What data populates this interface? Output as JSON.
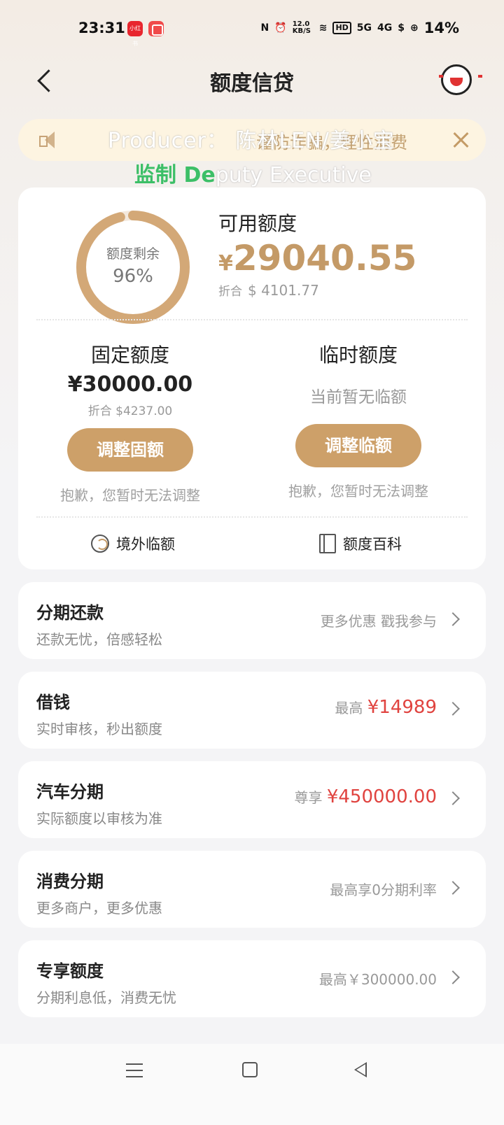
{
  "status_bar": {
    "time": "23:31",
    "app_badge": "小红书",
    "net_speed": "12.0 KB/S",
    "hd": "HD",
    "sig1": "5G",
    "sig2": "4G",
    "battery": "14%"
  },
  "header": {
    "title": "额度信贷",
    "back_icon": "back-arrow-icon",
    "mascot_icon": "mascot-icon"
  },
  "notice": {
    "text": "谨防诈骗，理性消费",
    "watermark_line1": "Producer：  陈林LEN/姜小宝",
    "watermark_line2_green": "监制 De",
    "watermark_line2_rest": "puty Executive"
  },
  "credit": {
    "ring_label": "额度剩余",
    "ring_percent_text": "96%",
    "remaining_fraction": 0.96,
    "available_label": "可用额度",
    "available_currency": "¥",
    "available_amount": "29040.55",
    "available_usd_prefix": "折合",
    "available_usd": "$ 4101.77",
    "fixed": {
      "title": "固定额度",
      "amount": "¥30000.00",
      "usd": "折合 $4237.00",
      "button": "调整固额",
      "note": "抱歉，您暂时无法调整"
    },
    "temp": {
      "title": "临时额度",
      "empty": "当前暂无临额",
      "button": "调整临额",
      "note": "抱歉，您暂时无法调整"
    },
    "tools": {
      "overseas": "境外临额",
      "wiki": "额度百科"
    }
  },
  "services": [
    {
      "title": "分期还款",
      "sub": "还款无忧，倍感轻松",
      "right_prefix": "更多优惠 戳我参与",
      "right_value": ""
    },
    {
      "title": "借钱",
      "sub": "实时审核，秒出额度",
      "right_prefix": "最高",
      "right_value": "¥14989"
    },
    {
      "title": "汽车分期",
      "sub": "实际额度以审核为准",
      "right_prefix": "尊享",
      "right_value": "¥450000.00"
    },
    {
      "title": "消费分期",
      "sub": "更多商户，更多优惠",
      "right_prefix": "最高享0分期利率",
      "right_value": ""
    },
    {
      "title": "专享额度",
      "sub": "分期利息低，消费无忧",
      "right_prefix": "最高￥300000.00",
      "right_value": ""
    }
  ],
  "colors": {
    "accent": "#cda069",
    "accent_text": "#c49a67",
    "highlight_red": "#e0433f",
    "ring_track": "#f1e6da"
  }
}
